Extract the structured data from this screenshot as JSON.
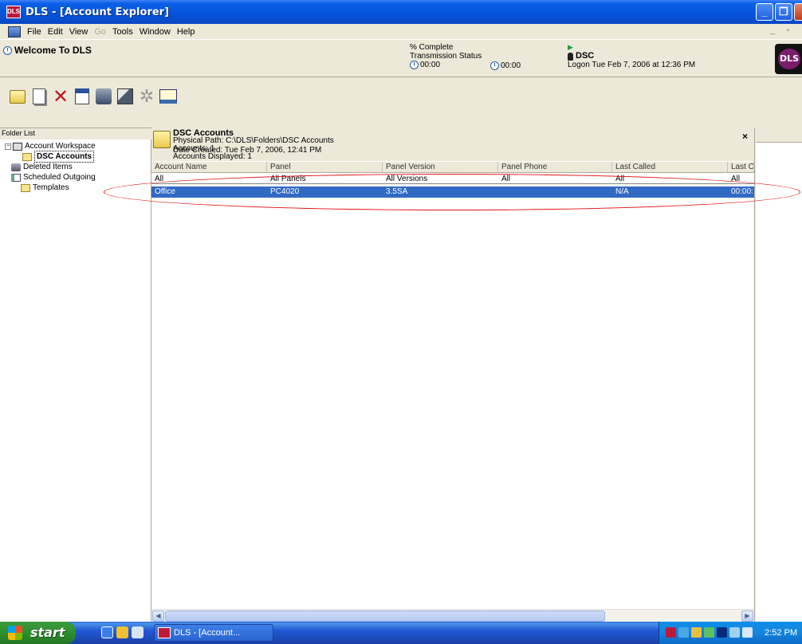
{
  "window": {
    "title": "DLS - [Account Explorer]",
    "app_icon_label": "DLS"
  },
  "menu": [
    "File",
    "Edit",
    "View",
    "Go",
    "Tools",
    "Window",
    "Help"
  ],
  "info": {
    "welcome": "Welcome To DLS",
    "percent_complete": "% Complete",
    "transmission_status": "Transmission Status",
    "timer1": "00:00",
    "timer2": "00:00",
    "user": "DSC",
    "logon": "Logon Tue Feb 7, 2006 at 12:36 PM",
    "logo": "DLS"
  },
  "folder_list": {
    "header": "Folder List",
    "items": [
      {
        "label": "Account Workspace"
      },
      {
        "label": "DSC Accounts"
      },
      {
        "label": "Deleted Items"
      },
      {
        "label": "Scheduled Outgoing"
      },
      {
        "label": "Templates"
      }
    ]
  },
  "explorer": {
    "title": "DSC Accounts",
    "physical_path": "Physical Path: C:\\DLS\\Folders\\DSC Accounts",
    "accounts": "Accounts: 1",
    "accounts_displayed": "Accounts Displayed: 1",
    "date_created": "Date Created: Tue Feb 7, 2006, 12:41 PM",
    "close": "×",
    "columns": [
      "Account Name",
      "Panel",
      "Panel Version",
      "Panel Phone",
      "Last Called",
      "Last C"
    ],
    "filter": [
      "All",
      "All Panels",
      "All Versions",
      "All",
      "All",
      "All"
    ],
    "rows": [
      [
        "Office",
        "PC4020",
        "3.5SA",
        "",
        "N/A",
        "00:00:"
      ]
    ]
  },
  "taskbar": {
    "start": "start",
    "task": "DLS - [Account...",
    "clock": "2:52 PM"
  },
  "colors": {
    "selection": "#316ac5",
    "annotation": "#e01010"
  }
}
